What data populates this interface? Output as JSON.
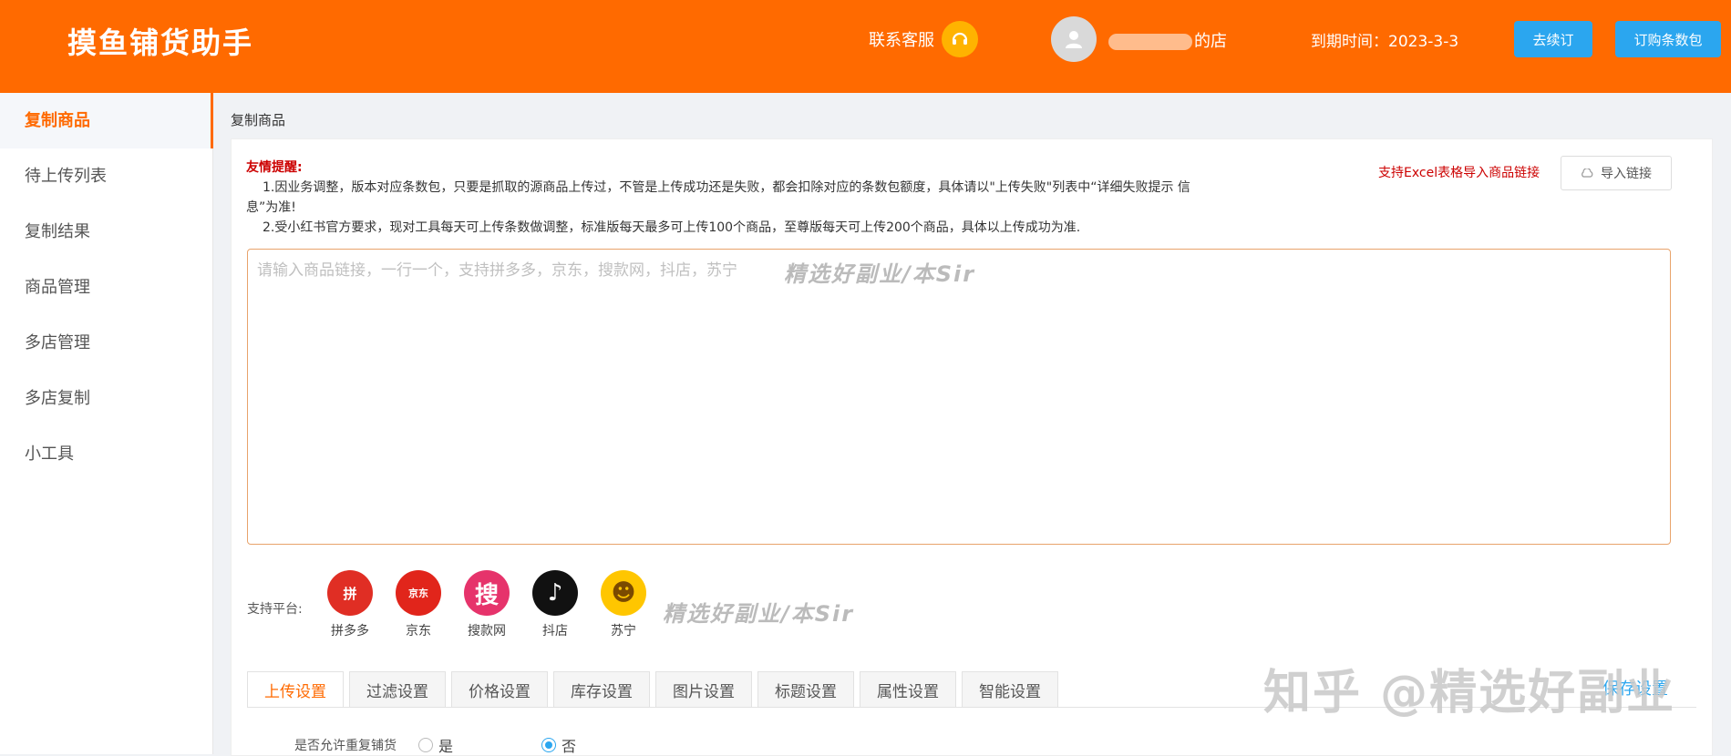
{
  "header": {
    "logo": "摸鱼铺货助手",
    "customer_service": "联系客服",
    "shop_name": "的店",
    "expire": "到期时间：2023-3-3",
    "renew_button": "去续订",
    "buy_pack_button": "订购条数包"
  },
  "sidebar": {
    "items": [
      {
        "label": "复制商品",
        "active": true
      },
      {
        "label": "待上传列表"
      },
      {
        "label": "复制结果"
      },
      {
        "label": "商品管理"
      },
      {
        "label": "多店管理"
      },
      {
        "label": "多店复制"
      },
      {
        "label": "小工具"
      }
    ]
  },
  "main": {
    "breadcrumb": "复制商品",
    "notice_title": "友情提醒:",
    "notice_1": "1.因业务调整，版本对应条数包，只要是抓取的源商品上传过，不管是上传成功还是失败，都会扣除对应的条数包额度，具体请以\"上传失败\"列表中“详细失败提示 信息”为准!",
    "notice_2": "2.受小红书官方要求，现对工具每天可上传条数做调整，标准版每天最多可上传100个商品，至尊版每天可上传200个商品，具体以上传成功为准.",
    "excel_tip": "支持Excel表格导入商品链接",
    "import_button": "导入链接",
    "textarea_placeholder": "请输入商品链接，一行一个，支持拼多多，京东，搜款网，抖店，苏宁",
    "watermark": "精选好副业/本Sir",
    "platform_label": "支持平台:",
    "platforms": [
      {
        "name": "拼多多",
        "glyph": "拼",
        "color": "#e02e24"
      },
      {
        "name": "京东",
        "glyph": "京东",
        "color": "#e1251b"
      },
      {
        "name": "搜款网",
        "glyph": "搜",
        "color": "#e6336b"
      },
      {
        "name": "抖店",
        "glyph": "♪",
        "color": "#111111"
      },
      {
        "name": "苏宁",
        "glyph": "☻",
        "color": "#ffc600"
      }
    ],
    "tabs": [
      "上传设置",
      "过滤设置",
      "价格设置",
      "库存设置",
      "图片设置",
      "标题设置",
      "属性设置",
      "智能设置"
    ],
    "save_settings": "保存设置",
    "zhihu_watermark": "知乎 @精选好副业",
    "dup_label": "是否允许重复铺货",
    "option_yes": "是",
    "option_no": "否"
  },
  "colors": {
    "brand": "#ff6a00",
    "accent": "#2ba6ef"
  }
}
